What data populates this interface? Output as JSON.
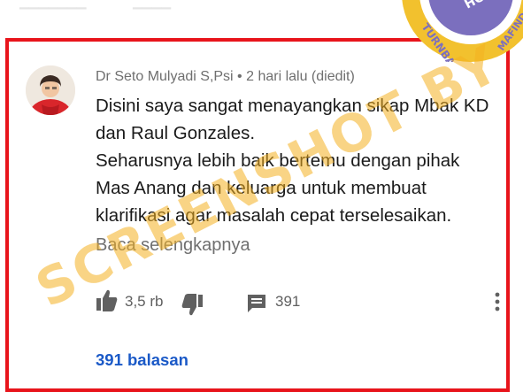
{
  "comment": {
    "author": "Dr Seto Mulyadi S,Psi",
    "meta_suffix": " • 2 hari lalu (diedit)",
    "lines": [
      "Disini saya sangat menayangkan sikap Mbak KD",
      "dan Raul Gonzales.",
      "Seharusnya lebih baik bertemu dengan pihak",
      "Mas Anang dan keluarga untuk membuat",
      "klarifikasi agar masalah cepat terselesaikan."
    ],
    "read_more": "Baca selengkapnya",
    "like_count": "3,5 rb",
    "reply_count": "391",
    "replies_link": "391 balasan"
  },
  "overlay": {
    "watermark": "SCREENSHOT BY",
    "badge_text_left": "TURNBACKHOAX",
    "badge_text_right": "MAFINDO",
    "badge_inner": "HOAX"
  },
  "colors": {
    "highlight_border": "#e8141b",
    "link": "#1a59c7",
    "watermark": "#f4b020",
    "badge": "#f2c12e"
  }
}
